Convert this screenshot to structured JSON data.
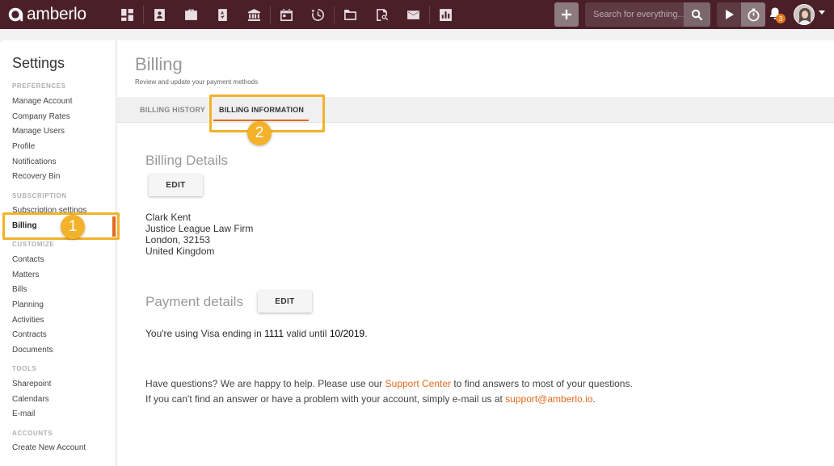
{
  "topbar": {
    "brand": "amberlo",
    "nav_icons": [
      "dashboard-icon",
      "contacts-icon",
      "matters-icon",
      "bills-icon",
      "bank-icon",
      "calendar-icon",
      "time-entries-icon",
      "documents-icon",
      "document-review-icon",
      "mail-icon",
      "reports-icon"
    ],
    "search_placeholder": "Search for everything...",
    "notification_count": "3"
  },
  "sidebar": {
    "title": "Settings",
    "sections": [
      {
        "label": "PREFERENCES",
        "items": [
          "Manage Account",
          "Company Rates",
          "Manage Users",
          "Profile",
          "Notifications",
          "Recovery Bin"
        ]
      },
      {
        "label": "SUBSCRIPTION",
        "items": [
          "Subscription settings",
          "Billing"
        ]
      },
      {
        "label": "CUSTOMIZE",
        "items": [
          "Contacts",
          "Matters",
          "Bills",
          "Planning",
          "Activities",
          "Contracts",
          "Documents"
        ]
      },
      {
        "label": "TOOLS",
        "items": [
          "Sharepoint",
          "Calendars",
          "E-mail"
        ]
      },
      {
        "label": "ACCOUNTS",
        "items": [
          "Create New Account"
        ]
      }
    ],
    "active_item": "Billing"
  },
  "main": {
    "title": "Billing",
    "subtitle": "Review and update your payment methods",
    "tabs": [
      {
        "label": "BILLING HISTORY"
      },
      {
        "label": "BILLING INFORMATION",
        "active": true
      }
    ],
    "billing_details": {
      "heading": "Billing Details",
      "edit_label": "EDIT",
      "address_lines": [
        "Clark Kent",
        "Justice League Law Firm",
        "London, 32153",
        "United Kingdom"
      ]
    },
    "payment_details": {
      "heading": "Payment details",
      "edit_label": "EDIT",
      "text_prefix": "You're using Visa ending in ",
      "card_last4": "1111",
      "text_mid": " valid until ",
      "expiry": "10/2019",
      "text_suffix": "."
    },
    "help": {
      "line1_prefix": "Have questions? We are happy to help. Please use our ",
      "line1_link": "Support Center",
      "line1_suffix": " to find answers to most of your questions.",
      "line2_prefix": "If you can't find an answer or have a problem with your account, simply e-mail us at ",
      "line2_link": "support@amberlo.io",
      "line2_suffix": "."
    }
  },
  "annotations": {
    "marker_1": "1",
    "marker_2": "2",
    "color": "#f3b229"
  },
  "colors": {
    "topbar": "#4a1f28",
    "accent": "#e46a1c"
  }
}
